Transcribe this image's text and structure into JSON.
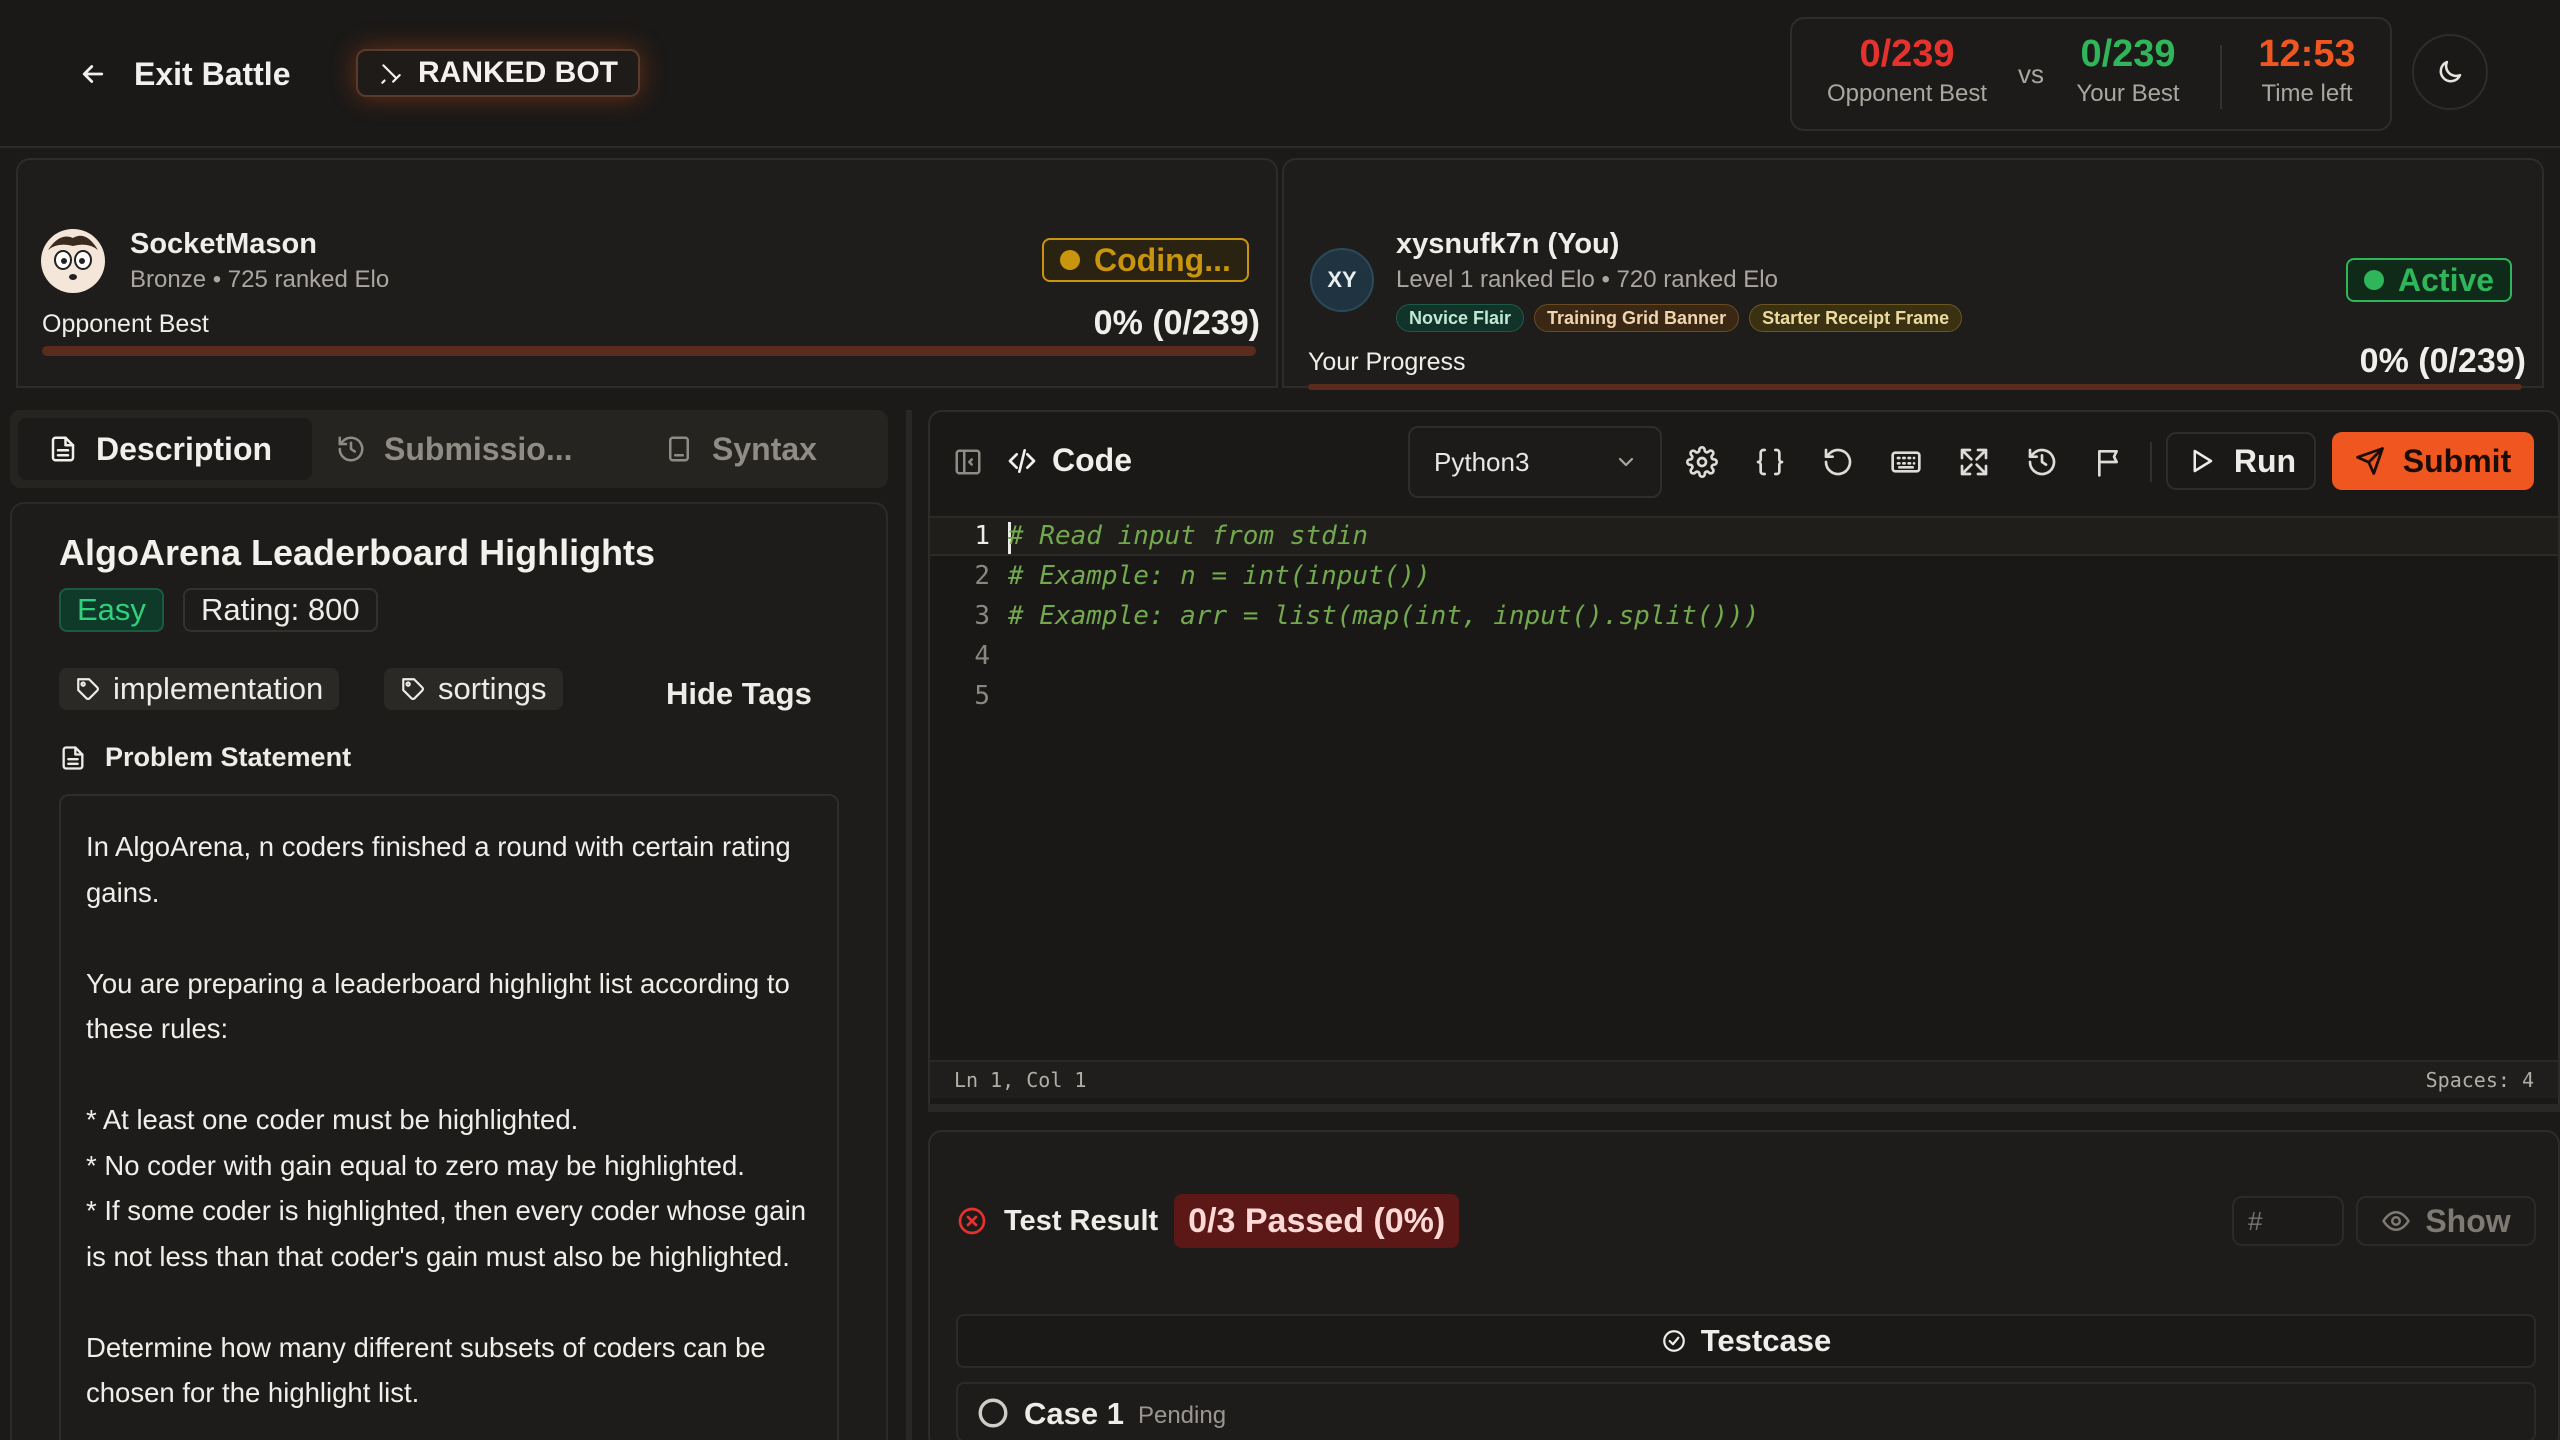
{
  "header": {
    "exit_label": "Exit Battle",
    "mode_badge": "RANKED BOT",
    "score": {
      "opponent_value": "0/239",
      "opponent_label": "Opponent Best",
      "vs": "vs",
      "you_value": "0/239",
      "you_label": "Your Best",
      "time_value": "12:53",
      "time_label": "Time left"
    }
  },
  "opponent": {
    "name": "SocketMason",
    "subtitle": "Bronze • 725 ranked Elo",
    "status": "Coding...",
    "progress_label": "Opponent Best",
    "progress_value": "0% (0/239)",
    "progress_fraction": 0
  },
  "player": {
    "avatar_initials": "XY",
    "name": "xysnufk7n (You)",
    "subtitle": "Level 1 ranked Elo • 720 ranked Elo",
    "flairs": [
      "Novice Flair",
      "Training Grid Banner",
      "Starter Receipt Frame"
    ],
    "status": "Active",
    "progress_label": "Your Progress",
    "progress_value": "0% (0/239)",
    "progress_fraction": 0
  },
  "left_tabs": {
    "description": "Description",
    "submissions": "Submissio...",
    "syntax": "Syntax"
  },
  "problem": {
    "title": "AlgoArena Leaderboard Highlights",
    "difficulty": "Easy",
    "rating": "Rating: 800",
    "tags": [
      "implementation",
      "sortings"
    ],
    "hide_tags": "Hide Tags",
    "statement_heading": "Problem Statement",
    "statement": "In AlgoArena, n coders finished a round with certain rating gains.\n\nYou are preparing a leaderboard highlight list according to these rules:\n\n* At least one coder must be highlighted.\n* No coder with gain equal to zero may be highlighted.\n* If some coder is highlighted, then every coder whose gain is not less than that coder's gain must also be highlighted.\n\nDetermine how many different subsets of coders can be chosen for the highlight list."
  },
  "editor": {
    "title": "Code",
    "language": "Python3",
    "run_label": "Run",
    "submit_label": "Submit",
    "lines": [
      {
        "num": "1",
        "code": "# Read input from stdin"
      },
      {
        "num": "2",
        "code": "# Example: n = int(input())"
      },
      {
        "num": "3",
        "code": "# Example: arr = list(map(int, input().split()))"
      },
      {
        "num": "4",
        "code": ""
      },
      {
        "num": "5",
        "code": ""
      }
    ],
    "cursor": "Ln 1, Col 1",
    "indent": "Spaces: 4"
  },
  "tests": {
    "result_label": "Test Result",
    "passed": "0/3 Passed (0%)",
    "filter_placeholder": "#",
    "show_label": "Show",
    "testcase_label": "Testcase",
    "case_name": "Case 1",
    "case_status": "Pending"
  },
  "colors": {
    "accent": "#f0561f",
    "red": "#e5322d",
    "green": "#2fb55a",
    "amber": "#c9950f"
  }
}
